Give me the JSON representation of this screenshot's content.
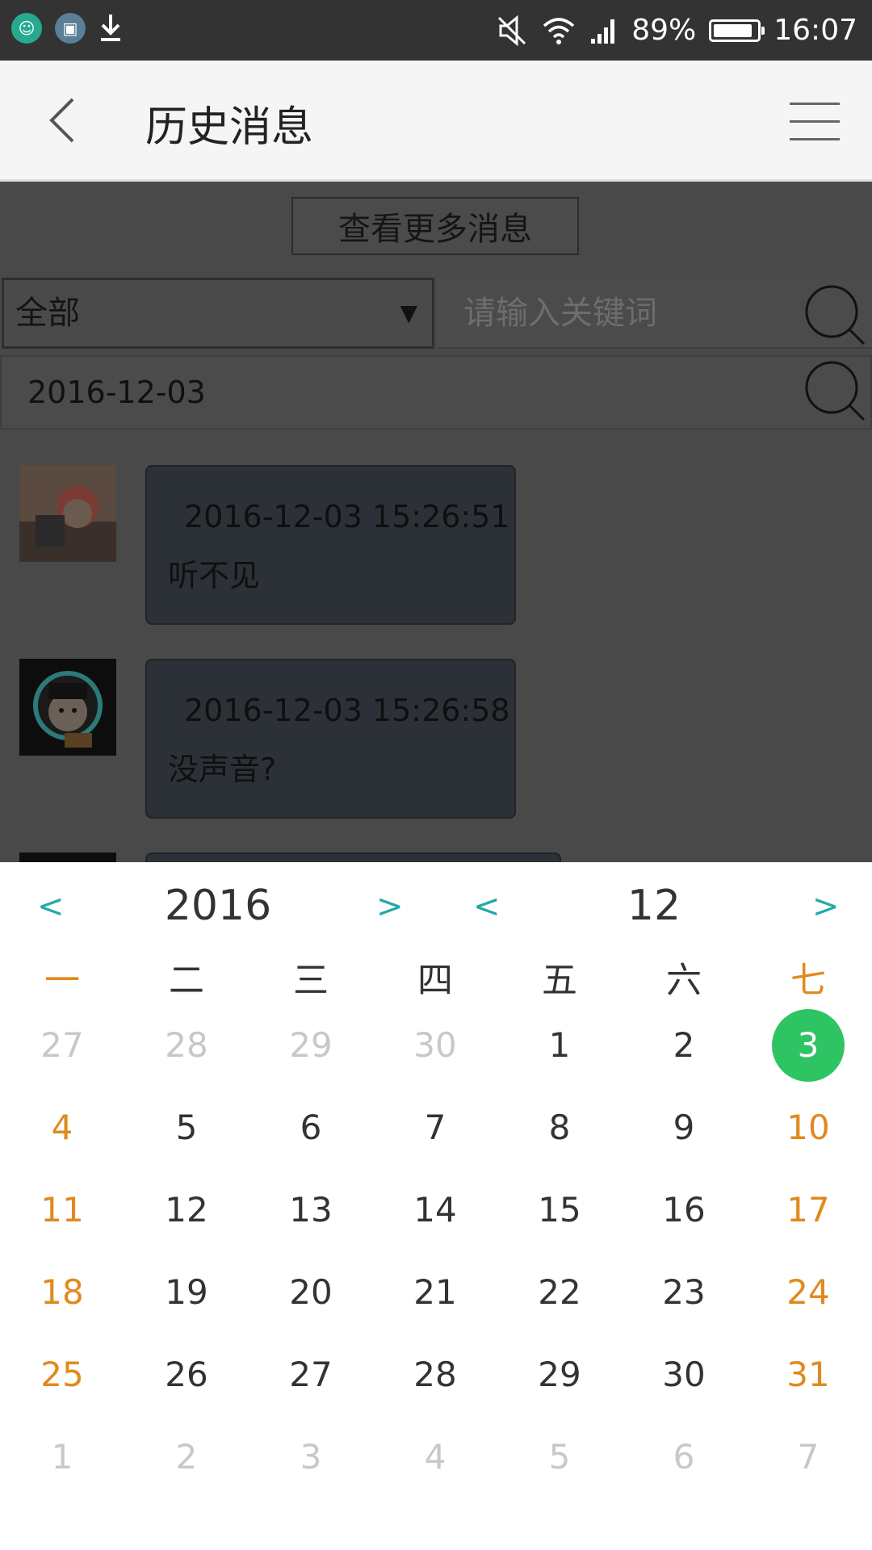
{
  "status_bar": {
    "battery": "89%",
    "time": "16:07"
  },
  "app_bar": {
    "title": "历史消息"
  },
  "content": {
    "more_button": "查看更多消息",
    "filter_select": "全部",
    "keyword_placeholder": "请输入关键词",
    "date_value": "2016-12-03",
    "messages": [
      {
        "time": "2016-12-03 15:26:51",
        "text": "听不见"
      },
      {
        "time": "2016-12-03 15:26:58",
        "text": "没声音?"
      }
    ]
  },
  "calendar": {
    "prev_symbol": "<",
    "next_symbol": ">",
    "year": "2016",
    "month": "12",
    "weekdays": [
      "一",
      "二",
      "三",
      "四",
      "五",
      "六",
      "七"
    ],
    "weeks": [
      [
        "27",
        "28",
        "29",
        "30",
        "1",
        "2",
        "3"
      ],
      [
        "4",
        "5",
        "6",
        "7",
        "8",
        "9",
        "10"
      ],
      [
        "11",
        "12",
        "13",
        "14",
        "15",
        "16",
        "17"
      ],
      [
        "18",
        "19",
        "20",
        "21",
        "22",
        "23",
        "24"
      ],
      [
        "25",
        "26",
        "27",
        "28",
        "29",
        "30",
        "31"
      ],
      [
        "1",
        "2",
        "3",
        "4",
        "5",
        "6",
        "7"
      ]
    ],
    "selected_day": "3",
    "colors": {
      "accent_nav": "#25a8a8",
      "weekend": "#e08a1e",
      "selected": "#2ec463",
      "outside_month": "#c8c8c8"
    }
  }
}
